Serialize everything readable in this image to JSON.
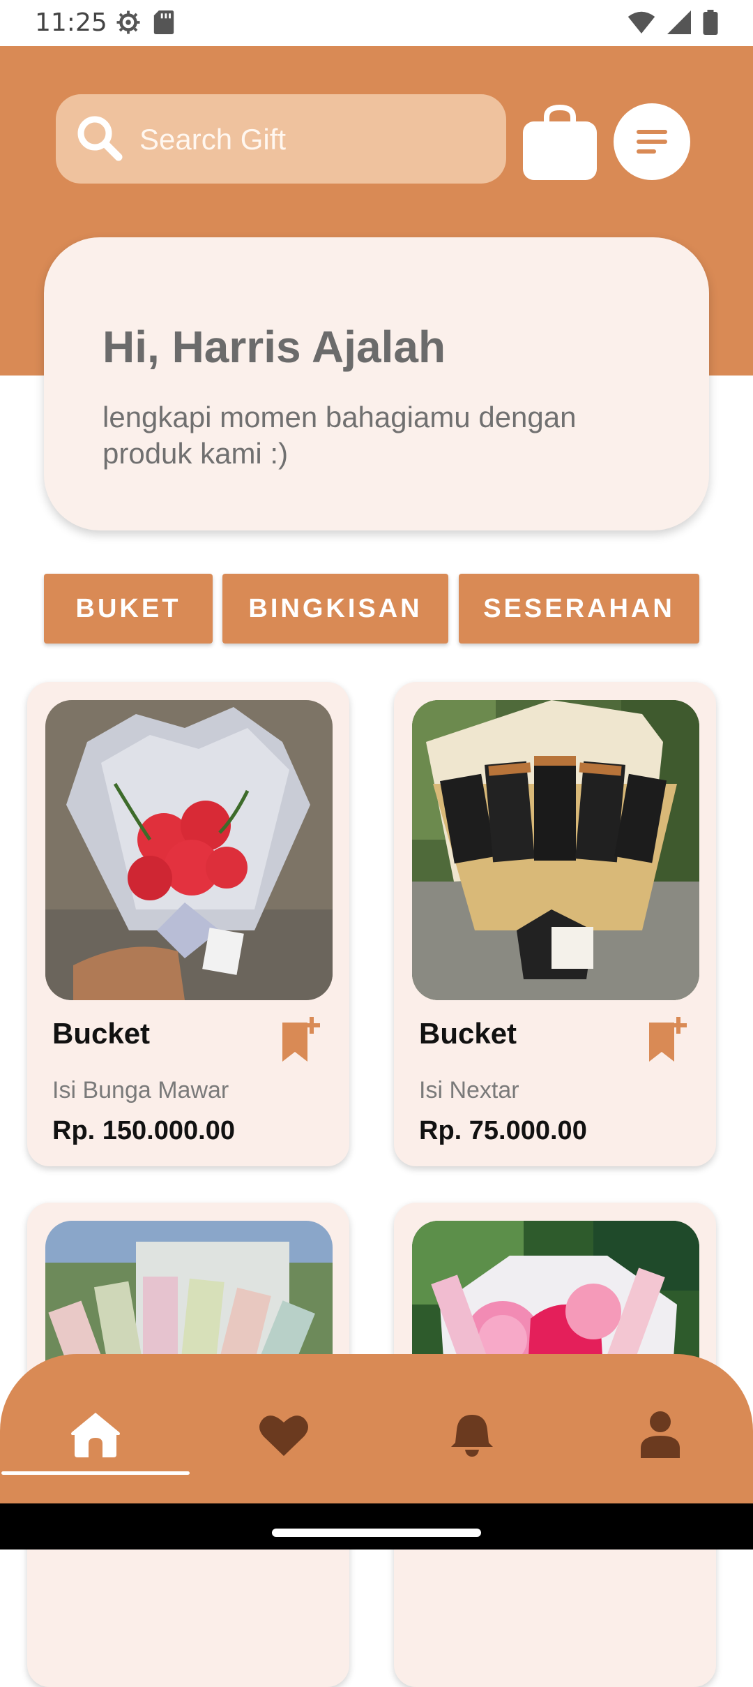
{
  "status": {
    "time": "11:25"
  },
  "search": {
    "placeholder": "Search Gift"
  },
  "greeting": {
    "title": "Hi, Harris Ajalah",
    "subtitle": "lengkapi momen bahagiamu dengan produk kami :)"
  },
  "categories": [
    {
      "label": "BUKET"
    },
    {
      "label": "BINGKISAN"
    },
    {
      "label": "SESERAHAN"
    }
  ],
  "products": [
    {
      "title": "Bucket",
      "subtitle": "Isi Bunga Mawar",
      "price": "Rp. 150.000.00"
    },
    {
      "title": "Bucket",
      "subtitle": "Isi Nextar",
      "price": "Rp. 75.000.00"
    },
    {
      "title": "",
      "subtitle": "",
      "price": ""
    },
    {
      "title": "",
      "subtitle": "",
      "price": ""
    }
  ],
  "nav": {
    "items": [
      "home-icon",
      "heart-icon",
      "bell-icon",
      "person-icon"
    ],
    "active": "home"
  },
  "colors": {
    "primary": "#d98a55",
    "search_bg": "#efc29e",
    "card_bg": "#fbeee9",
    "nav_active": "#ffffff",
    "nav_inactive": "#6b3a1f"
  }
}
